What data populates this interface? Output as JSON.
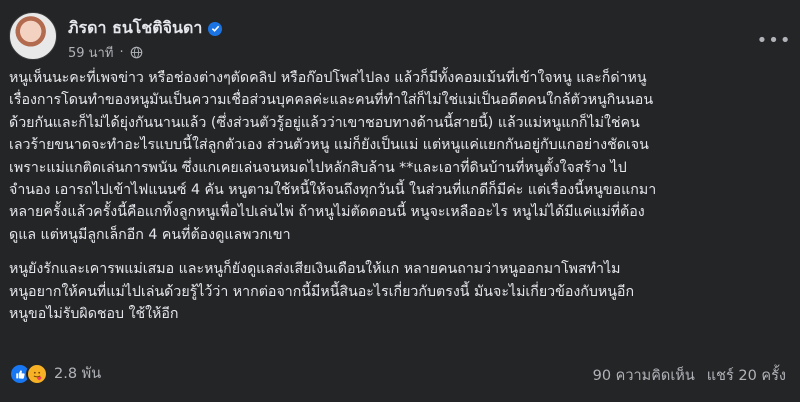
{
  "post": {
    "author": "ภิรดา ธนโชติจินดา",
    "timestamp": "59 นาที",
    "paragraphs": [
      [
        "หนูเห็นนะคะที่เพจข่าว หรือช่องต่างๆตัดคลิป หรือก๊อปโพสไปลง แล้วก็มีทั้งคอมเม้นที่เข้าใจหนู และก็ด่าหนู",
        "เรื่องการโดนทำของหนูมันเป็นความเชื่อส่วนบุคคลค่ะและคนที่ทำใส่ก็ไม่ใช่แม่เป็นอดีตคนใกล้ตัวหนูกินนอน",
        "ด้วยกันและก็ไม่ได้ยุ่งกันนานแล้ว (ซึ่งส่วนตัวรู้อยู่แล้วว่าเขาชอบทางด้านนี้สายนี้) แล้วแม่หนูแกก็ไม่ใช่คน",
        "เลวร้ายขนาดจะทำอะไรแบบนี้ใส่ลูกตัวเอง  ส่วนตัวหนู แม่ก็ยังเป็นแม่ แต่หนูแค่แยกกันอยู่กับแกอย่างชัดเจน",
        "เพราะแม่แกติดเล่นการพนัน ซึ่งแกเคยเล่นจนหมดไปหลักสิบล้าน **และเอาที่ดินบ้านที่หนูตั้งใจสร้าง ไป",
        "จำนอง เอารถไปเข้าไฟแนนซ์ 4 คัน หนูตามใช้หนี้ให้จนถึงทุกวันนี้ ในส่วนที่แกดีก็มีค่ะ แต่เรื่องนี้หนูขอแกมา",
        "หลายครั้งแล้วครั้งนี้คือแกทิ้งลูกหนูเพื่อไปเล่นไพ่ ถ้าหนูไม่ตัดตอนนี้ หนูจะเหลืออะไร หนูไม่ได้มีแค่แม่ที่ต้อง",
        "ดูแล แต่หนูมีลูกเล็กอีก 4 คนที่ต้องดูแลพวกเขา"
      ],
      [
        "หนูยังรักและเคารพแม่เสมอ และหนูก็ยังดูแลส่งเสียเงินเดือนให้แก   หลายคนถามว่าหนูออกมาโพสทำไม",
        "หนูอยากให้คนที่แม่ไปเล่นด้วยรู้ไว้ว่า หากต่อจากนี้มีหนี้สินอะไรเกี่ยวกับตรงนี้  มันจะไม่เกี่ยวข้องกับหนูอีก",
        "หนูขอไม่รับผิดชอบ ใช้ให้อีก"
      ]
    ]
  },
  "footer": {
    "reaction_count": "2.8 พัน",
    "comments": "90 ความคิดเห็น",
    "shares": "แชร์ 20 ครั้ง",
    "reactions": [
      "like-icon",
      "love-icon"
    ]
  },
  "colors": {
    "background": "#242526",
    "text": "#e4e6eb",
    "secondary": "#b0b3b8",
    "verified": "#1b74e4",
    "like": "#1877f2"
  }
}
